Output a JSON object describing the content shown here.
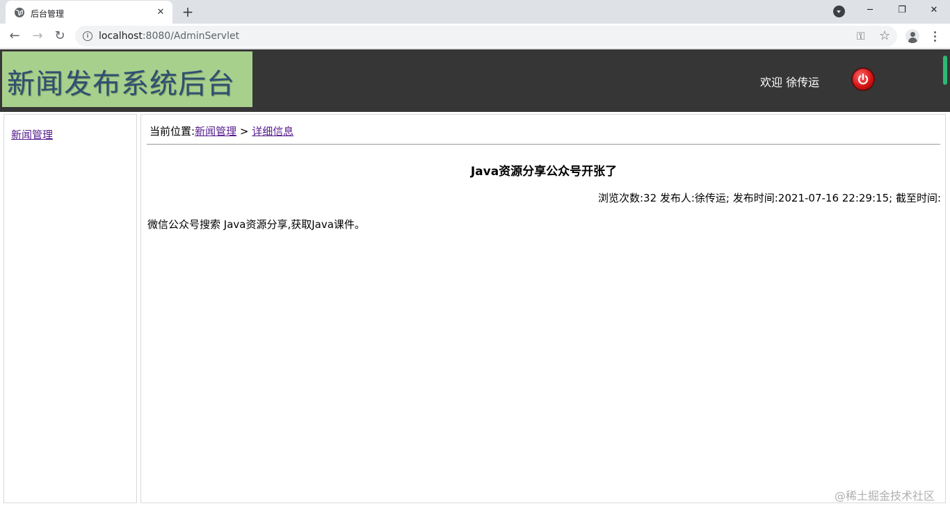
{
  "browser": {
    "tab_title": "后台管理",
    "url_host": "localhost",
    "url_rest": ":8080/AdminServlet"
  },
  "header": {
    "logo_text": "新闻发布系统后台",
    "welcome": "欢迎 徐传运"
  },
  "sidebar": {
    "items": [
      {
        "label": "新闻管理"
      }
    ]
  },
  "breadcrumb": {
    "prefix": "当前位置:",
    "link1": "新闻管理",
    "separator": " > ",
    "link2": "详细信息"
  },
  "article": {
    "title": "Java资源分享公众号开张了",
    "meta": "浏览次数:32 发布人:徐传运; 发布时间:2021-07-16 22:29:15; 截至时间:",
    "content": "微信公众号搜索 Java资源分享,获取Java课件。"
  },
  "watermark": "@稀土掘金技术社区",
  "colors": {
    "header_bg": "#363636",
    "logo_bg": "#a8d08d",
    "logo_text": "#2e4f73",
    "link": "#551a8b",
    "power_button": "#d81616"
  }
}
